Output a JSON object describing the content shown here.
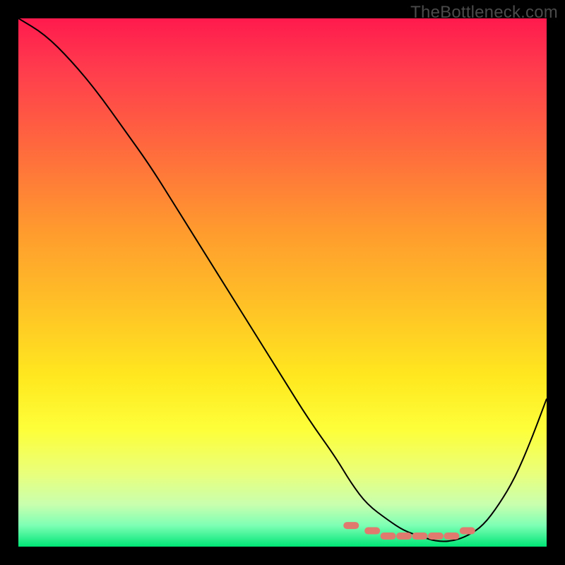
{
  "watermark": "TheBottleneck.com",
  "chart_data": {
    "type": "line",
    "title": "",
    "xlabel": "",
    "ylabel": "",
    "xlim": [
      0,
      100
    ],
    "ylim": [
      0,
      100
    ],
    "series": [
      {
        "name": "curve",
        "x": [
          0,
          5,
          10,
          15,
          20,
          25,
          30,
          35,
          40,
          45,
          50,
          55,
          60,
          63,
          66,
          70,
          73,
          76,
          79,
          82,
          85,
          88,
          91,
          94,
          97,
          100
        ],
        "values": [
          100,
          97,
          92,
          86,
          79,
          72,
          64,
          56,
          48,
          40,
          32,
          24,
          17,
          12,
          8,
          5,
          3,
          2,
          1,
          1,
          2,
          4,
          8,
          13,
          20,
          28
        ]
      }
    ],
    "markers": {
      "x": [
        63,
        67,
        70,
        73,
        76,
        79,
        82,
        85
      ],
      "values": [
        4,
        3,
        2,
        2,
        2,
        2,
        2,
        3
      ],
      "color": "#e07a6f"
    },
    "colors": {
      "curve_stroke": "#000000",
      "marker_fill": "#e07a6f"
    }
  }
}
